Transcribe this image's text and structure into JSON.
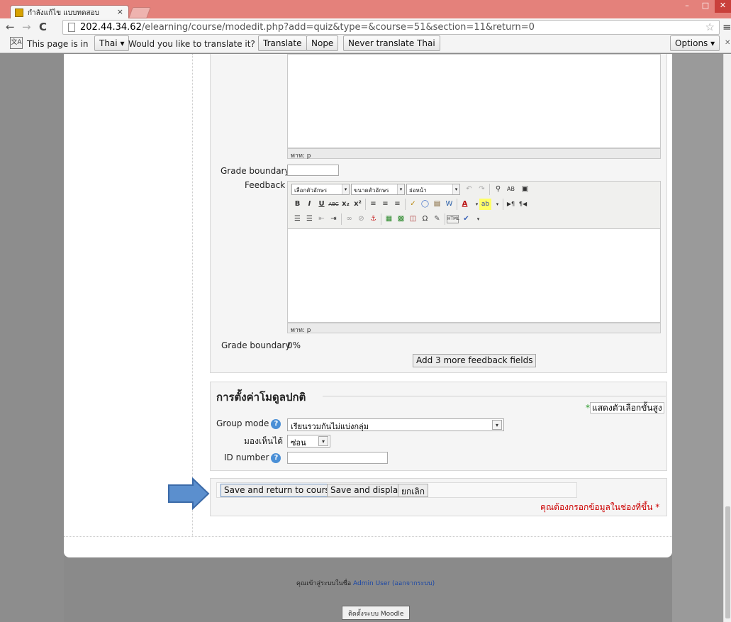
{
  "browser": {
    "tab_title": "กำลังแก้ไข แบบทดสอบ",
    "tab_close": "×",
    "url_host": "202.44.34.62",
    "url_path": "/elearning/course/modedit.php?add=quiz&type=&course=51&section=11&return=0",
    "translate_bar": {
      "prefix": "This page is in",
      "language": "Thai ▾",
      "question": "Would you like to translate it?",
      "translate_label": "Translate",
      "nope_label": "Nope",
      "never_label": "Never translate Thai",
      "options_label": "Options ▾"
    }
  },
  "feedback_section": {
    "path_label_1": "พาท: p",
    "grade_boundary_label": "Grade boundary",
    "feedback_label": "Feedback",
    "font_family_select": "เลือกตัวอักษร",
    "font_size_select": "ขนาดตัวอักษร",
    "paragraph_select": "ย่อหน้า",
    "path_label_2": "พาท: p",
    "final_grade_boundary_label": "Grade boundary",
    "final_grade_boundary_value": "0%",
    "add_more_label": "Add 3 more feedback fields"
  },
  "module_settings": {
    "legend": "การตั้งค่าโมดูลปกติ",
    "advanced_marker": "*",
    "advanced_label": "แสดงตัวเลือกขั้นสูง",
    "group_mode_label": "Group mode",
    "group_mode_value": "เรียนรวมกันไม่แบ่งกลุ่ม",
    "visible_label": "มองเห็นได้",
    "visible_value": "ซ่อน",
    "id_number_label": "ID number",
    "help_glyph": "?"
  },
  "actions": {
    "save_return_label": "Save and return to course",
    "save_display_label": "Save and display",
    "cancel_label": "ยกเลิก",
    "required_note": "คุณต้องกรอกข้อมูลในช่องที่ขึ้น",
    "required_marker": "*"
  },
  "footer": {
    "logged_in_prefix": "คุณเข้าสู่ระบบในชื่อ",
    "user_name": "Admin User",
    "logout_label": "(ออกจากระบบ)",
    "moodle_button": "ติดตั้งระบบ Moodle"
  }
}
